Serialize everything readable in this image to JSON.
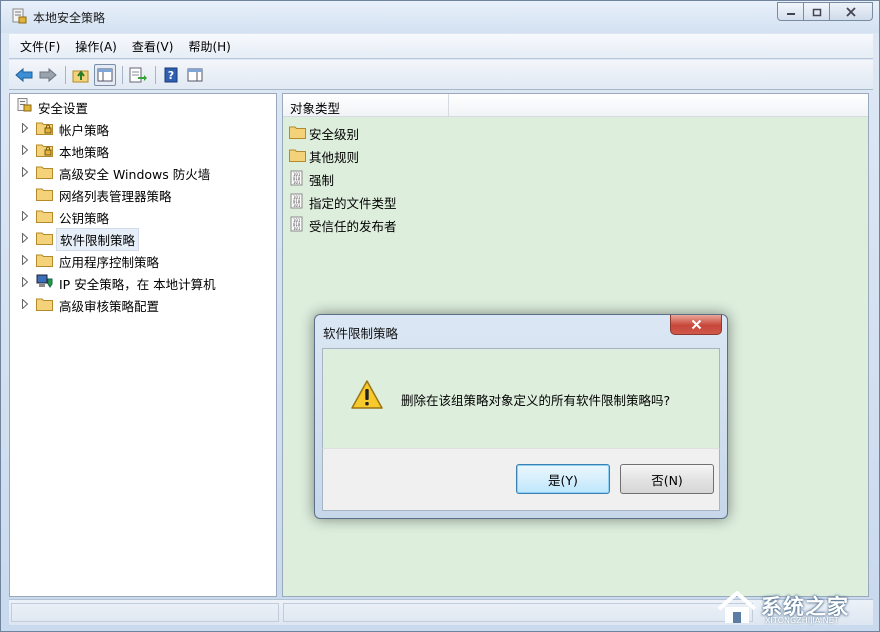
{
  "window": {
    "title": "本地安全策略"
  },
  "menu": [
    "文件(F)",
    "操作(A)",
    "查看(V)",
    "帮助(H)"
  ],
  "tree": {
    "root": "安全设置",
    "items": [
      {
        "label": "帐户策略",
        "expandable": true,
        "icon": "folder-lock-icon"
      },
      {
        "label": "本地策略",
        "expandable": true,
        "icon": "folder-lock-icon"
      },
      {
        "label": "高级安全 Windows 防火墙",
        "expandable": true,
        "icon": "folder-icon"
      },
      {
        "label": "网络列表管理器策略",
        "expandable": false,
        "icon": "folder-icon"
      },
      {
        "label": "公钥策略",
        "expandable": true,
        "icon": "folder-icon"
      },
      {
        "label": "软件限制策略",
        "expandable": true,
        "icon": "folder-icon",
        "selected": true
      },
      {
        "label": "应用程序控制策略",
        "expandable": true,
        "icon": "folder-icon"
      },
      {
        "label": "IP 安全策略，在 本地计算机",
        "expandable": true,
        "icon": "computer-shield-icon"
      },
      {
        "label": "高级审核策略配置",
        "expandable": true,
        "icon": "folder-icon"
      }
    ]
  },
  "list": {
    "column": "对象类型",
    "items": [
      {
        "label": "安全级别",
        "icon": "folder-icon"
      },
      {
        "label": "其他规则",
        "icon": "folder-icon"
      },
      {
        "label": "强制",
        "icon": "policy-doc-icon"
      },
      {
        "label": "指定的文件类型",
        "icon": "policy-doc-icon"
      },
      {
        "label": "受信任的发布者",
        "icon": "policy-doc-icon"
      }
    ]
  },
  "dialog": {
    "title": "软件限制策略",
    "message": "删除在该组策略对象定义的所有软件限制策略吗?",
    "yes_label": "是(Y)",
    "no_label": "否(N)"
  },
  "watermark": {
    "text": "系统之家",
    "subtext": "XITONGZHIJIA.NET"
  },
  "colors": {
    "content_bg": "#ddeedd",
    "window_frame": "#c9d9ee"
  }
}
